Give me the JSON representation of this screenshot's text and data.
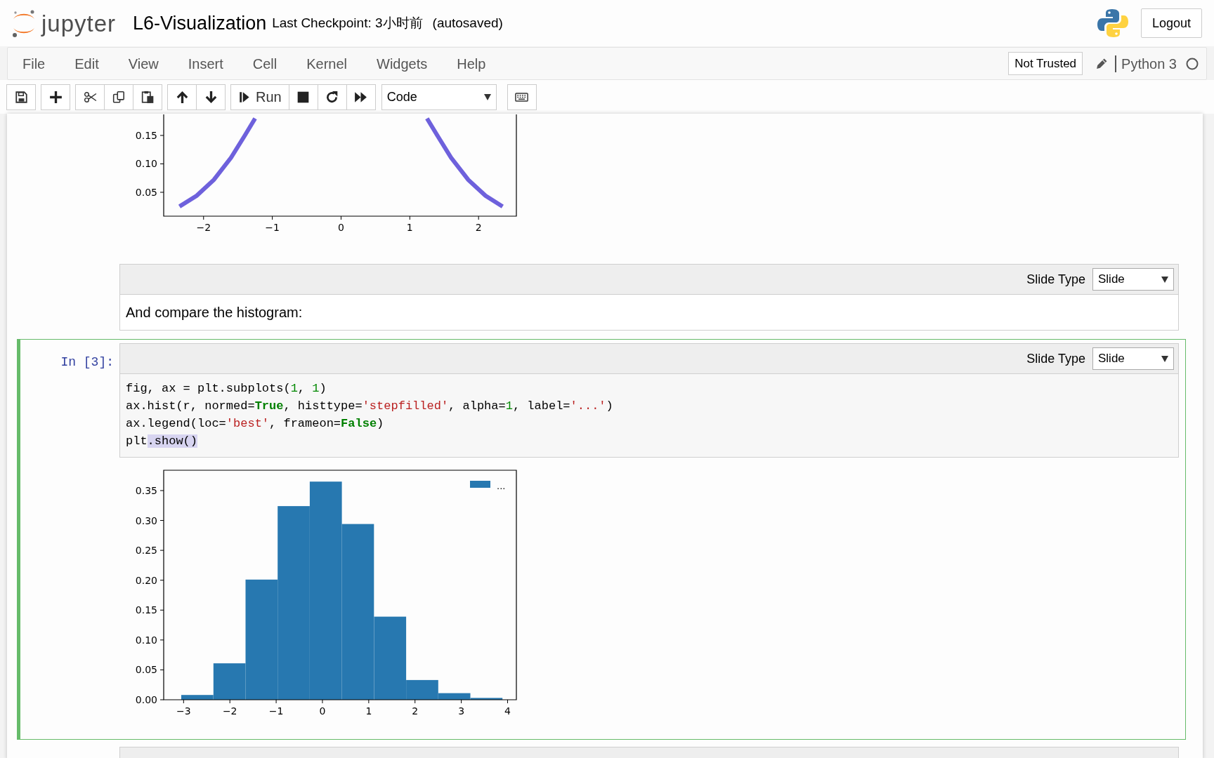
{
  "header": {
    "logo_text": "jupyter",
    "notebook_name": "L6-Visualization",
    "checkpoint": "Last Checkpoint: 3小时前",
    "autosave_status": "(autosaved)",
    "logout": "Logout"
  },
  "menubar": {
    "items": [
      "File",
      "Edit",
      "View",
      "Insert",
      "Cell",
      "Kernel",
      "Widgets",
      "Help"
    ],
    "trust_status": "Not Trusted",
    "kernel_name": "Python 3",
    "kernel_busy": false
  },
  "toolbar": {
    "groups": [
      [
        {
          "kind": "save"
        }
      ],
      [
        {
          "kind": "insert"
        }
      ],
      [
        {
          "kind": "cut"
        },
        {
          "kind": "copy"
        },
        {
          "kind": "paste"
        }
      ],
      [
        {
          "kind": "move-up"
        },
        {
          "kind": "move-down"
        }
      ],
      [
        {
          "kind": "run",
          "label": "Run"
        },
        {
          "kind": "interrupt"
        },
        {
          "kind": "restart"
        },
        {
          "kind": "run-all"
        }
      ]
    ],
    "cell_type": "Code",
    "palette": {
      "kind": "keyboard"
    }
  },
  "cells": [
    {
      "kind": "output",
      "selected": false,
      "output": {
        "chart_data": {
          "type": "line",
          "x": [
            -2.35,
            -2.1,
            -1.85,
            -1.6,
            -1.4,
            -1.25,
            0,
            1.25,
            1.4,
            1.6,
            1.85,
            2.1,
            2.35
          ],
          "series": [
            {
              "color": "#5e50d8",
              "values": [
                0.025,
                0.044,
                0.072,
                0.111,
                0.15,
                0.18,
                null,
                0.18,
                0.15,
                0.111,
                0.072,
                0.044,
                0.025
              ]
            }
          ],
          "xlim": [
            -2.58,
            2.55
          ],
          "ylim": [
            0.008,
            0.187
          ],
          "xticks": [
            {
              "value": -2,
              "label": "−2"
            },
            {
              "value": -1,
              "label": "−1"
            },
            {
              "value": 0,
              "label": "0"
            },
            {
              "value": 1,
              "label": "1"
            },
            {
              "value": 2,
              "label": "2"
            }
          ],
          "yticks": [
            {
              "value": 0.05,
              "label": "0.05"
            },
            {
              "value": 0.1,
              "label": "0.10"
            },
            {
              "value": 0.15,
              "label": "0.15"
            }
          ]
        }
      }
    },
    {
      "kind": "markdown",
      "selected": false,
      "slide_type_label": "Slide Type",
      "slide_type": "Slide",
      "text": "And compare the histogram:"
    },
    {
      "kind": "code",
      "selected": true,
      "prompt": "In [3]:",
      "slide_type_label": "Slide Type",
      "slide_type": "Slide",
      "lines": [
        [
          {
            "text": "fig, ax = plt.subplots(",
            "kind": "plain"
          },
          {
            "text": "1",
            "kind": "number"
          },
          {
            "text": ", ",
            "kind": "plain"
          },
          {
            "text": "1",
            "kind": "number"
          },
          {
            "text": ")",
            "kind": "plain"
          }
        ],
        [
          {
            "text": "ax.hist(r, normed=",
            "kind": "plain"
          },
          {
            "text": "True",
            "kind": "keyword"
          },
          {
            "text": ", histtype=",
            "kind": "plain"
          },
          {
            "text": "'stepfilled'",
            "kind": "string"
          },
          {
            "text": ", alpha=",
            "kind": "plain"
          },
          {
            "text": "1",
            "kind": "number"
          },
          {
            "text": ", label=",
            "kind": "plain"
          },
          {
            "text": "'...'",
            "kind": "string"
          },
          {
            "text": ")",
            "kind": "plain"
          }
        ],
        [
          {
            "text": "ax.legend(loc=",
            "kind": "plain"
          },
          {
            "text": "'best'",
            "kind": "string"
          },
          {
            "text": ", frameon=",
            "kind": "plain"
          },
          {
            "text": "False",
            "kind": "keyword"
          },
          {
            "text": ")",
            "kind": "plain"
          }
        ],
        [
          {
            "text": "plt",
            "kind": "plain"
          },
          {
            "text": ".show()",
            "kind": "selection"
          }
        ]
      ],
      "output": {
        "chart_data": {
          "type": "bar",
          "x": [
            -2.703,
            -2.009,
            -1.315,
            -0.621,
            0.073,
            0.767,
            1.461,
            2.155,
            2.849,
            3.543
          ],
          "series": [
            {
              "name": "...",
              "color": "#2778b0",
              "values": [
                0.008,
                0.061,
                0.201,
                0.324,
                0.365,
                0.294,
                0.139,
                0.033,
                0.011,
                0.003
              ]
            }
          ],
          "xlim": [
            -3.43,
            4.19
          ],
          "ylim": [
            0,
            0.384
          ],
          "xticks": [
            {
              "value": -3,
              "label": "−3"
            },
            {
              "value": -2,
              "label": "−2"
            },
            {
              "value": -1,
              "label": "−1"
            },
            {
              "value": 0,
              "label": "0"
            },
            {
              "value": 1,
              "label": "1"
            },
            {
              "value": 2,
              "label": "2"
            },
            {
              "value": 3,
              "label": "3"
            },
            {
              "value": 4,
              "label": "4"
            }
          ],
          "yticks": [
            {
              "value": 0,
              "label": "0.00"
            },
            {
              "value": 0.05,
              "label": "0.05"
            },
            {
              "value": 0.1,
              "label": "0.10"
            },
            {
              "value": 0.15,
              "label": "0.15"
            },
            {
              "value": 0.2,
              "label": "0.20"
            },
            {
              "value": 0.25,
              "label": "0.25"
            },
            {
              "value": 0.3,
              "label": "0.30"
            },
            {
              "value": 0.35,
              "label": "0.35"
            }
          ]
        }
      }
    },
    {
      "kind": "cut-off",
      "selected": false
    }
  ]
}
